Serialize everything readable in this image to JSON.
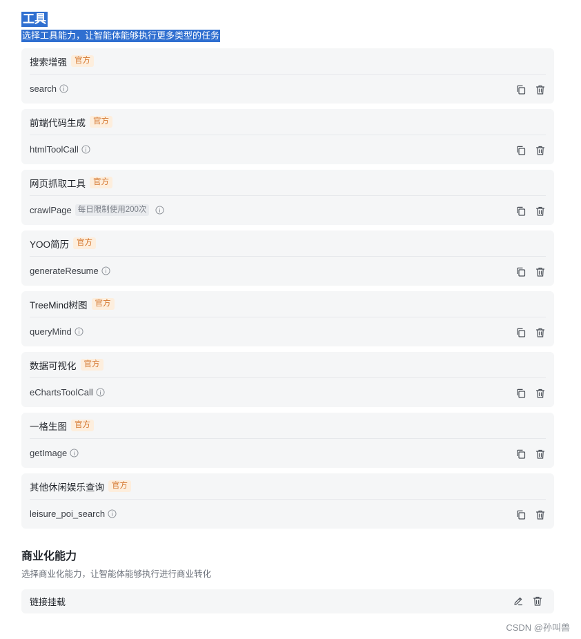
{
  "tools_section": {
    "title": "工具",
    "subtitle": "选择工具能力，让智能体能够执行更多类型的任务"
  },
  "badge_official": "官方",
  "tools": [
    {
      "name": "搜索增强",
      "func": "search"
    },
    {
      "name": "前端代码生成",
      "func": "htmlToolCall"
    },
    {
      "name": "网页抓取工具",
      "func": "crawlPage",
      "limit": "每日限制使用200次"
    },
    {
      "name": "YOO简历",
      "func": "generateResume"
    },
    {
      "name": "TreeMind树图",
      "func": "queryMind"
    },
    {
      "name": "数据可视化",
      "func": "eChartsToolCall"
    },
    {
      "name": "一格生图",
      "func": "getImage"
    },
    {
      "name": "其他休闲娱乐查询",
      "func": "leisure_poi_search"
    }
  ],
  "commercial_section": {
    "title": "商业化能力",
    "subtitle": "选择商业化能力，让智能体能够执行进行商业转化",
    "item_label": "链接挂载"
  },
  "watermark": "CSDN @孙叫兽",
  "icons": {
    "info": "info-circle-icon",
    "copy": "copy-icon",
    "delete": "trash-icon",
    "edit": "edit-pencil-icon"
  },
  "colors": {
    "selection": "#2f6fd0",
    "badge_bg": "#fdeedd",
    "badge_text": "#d4772f",
    "card_bg": "#f5f6f7"
  }
}
